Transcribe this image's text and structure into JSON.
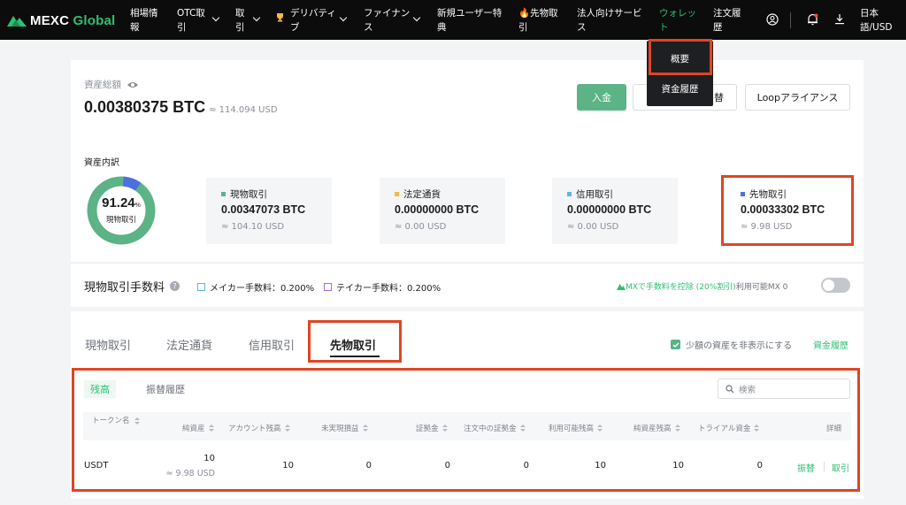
{
  "nav": {
    "brand_main": "MEXC",
    "brand_sub": "Global",
    "items": [
      {
        "line1": "相場情",
        "line2": "報"
      },
      {
        "line1": "OTC取",
        "line2": "引"
      },
      {
        "line1": "取",
        "line2": "引"
      },
      {
        "line1": "デリバティ",
        "line2": "ブ"
      },
      {
        "line1": "ファイナン",
        "line2": "ス"
      },
      {
        "line1": "新規ユーザー特",
        "line2": "典"
      },
      {
        "line1": "🔥先物取",
        "line2": "引"
      },
      {
        "line1": "法人向けサービ",
        "line2": "ス"
      },
      {
        "line1": "ウォレッ",
        "line2": "ト"
      },
      {
        "line1": "注文履",
        "line2": "歴"
      }
    ],
    "lang_line1": "日本",
    "lang_line2": "語/USD",
    "icons": [
      "user-icon",
      "bell-icon",
      "download-icon",
      "trophy-icon"
    ]
  },
  "wallet_menu": {
    "items": [
      "概要",
      "資金履歴"
    ]
  },
  "overview": {
    "total_label": "資産総額",
    "total_btc": "0.00380375 BTC",
    "total_usd": "≈ 114.094 USD",
    "deposit_label": "入金",
    "transfer_partial": "替",
    "loop_label": "Loopアライアンス",
    "breakdown_label": "資産内訳",
    "donut_value": "91.24",
    "donut_pct": "%",
    "donut_caption": "現物取引",
    "donut_fraction": 0.9124,
    "colors": {
      "green": "#5bb386",
      "blue": "#4d6fe0",
      "yellow": "#f5b942",
      "lightblue": "#5ab6e8"
    },
    "assets": [
      {
        "label": "現物取引",
        "btc": "0.00347073 BTC",
        "usd": "≈ 104.10 USD",
        "color": "#5bb386"
      },
      {
        "label": "法定通貨",
        "btc": "0.00000000 BTC",
        "usd": "≈ 0.00 USD",
        "color": "#f5b942"
      },
      {
        "label": "信用取引",
        "btc": "0.00000000 BTC",
        "usd": "≈ 0.00 USD",
        "color": "#5ab6e8"
      },
      {
        "label": "先物取引",
        "btc": "0.00033302 BTC",
        "usd": "≈ 9.98 USD",
        "color": "#4d6fe0"
      }
    ]
  },
  "fees": {
    "title": "現物取引手数料",
    "maker": "メイカー手数料：0.200%",
    "taker": "テイカー手数料：0.200%",
    "mx_discount": "MXで手数料を控除 (20%割引)",
    "mx_available": "利用可能MX 0"
  },
  "tabs": {
    "items": [
      "現物取引",
      "法定通貨",
      "信用取引",
      "先物取引"
    ],
    "hide_small": "少額の資産を非表示にする",
    "history_link": "資金履歴"
  },
  "futures": {
    "subtabs": [
      "残高",
      "振替履歴"
    ],
    "search_placeholder": "検索",
    "headers": [
      "トークン名",
      "純資産",
      "アカウント残高",
      "未実現損益",
      "証拠金",
      "注文中の証拠金",
      "利用可能残高",
      "純資産残高",
      "トライアル資金",
      "詳細"
    ],
    "row": {
      "token": "USDT",
      "net_assets": "10",
      "net_assets_usd": "≈ 9.98 USD",
      "account_balance": "10",
      "unrealized_pnl": "0",
      "margin": "0",
      "order_margin": "0",
      "available": "10",
      "net_asset_balance": "10",
      "trial_funds": "0",
      "transfer": "振替",
      "trade": "取引"
    }
  }
}
